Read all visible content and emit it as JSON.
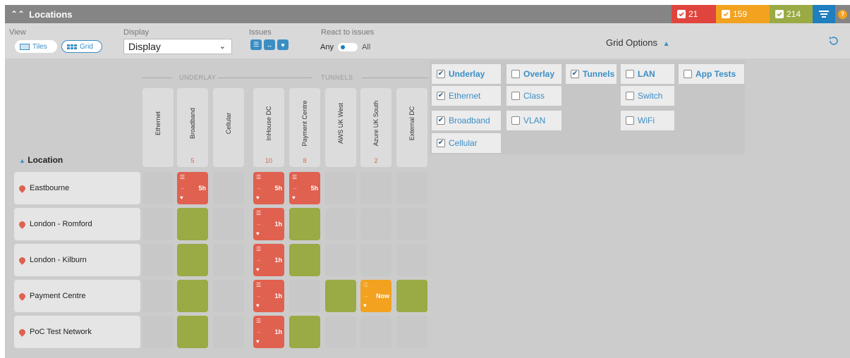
{
  "header": {
    "title": "Locations",
    "badges": [
      {
        "label": "21",
        "color": "#e0453d"
      },
      {
        "label": "159",
        "color": "#f2a21f"
      },
      {
        "label": "214",
        "color": "#9aaa44"
      }
    ],
    "filter_icon": "filter-icon",
    "help_label": "?"
  },
  "toolbar": {
    "view_label": "View",
    "view_options": [
      "Tiles",
      "Grid"
    ],
    "display_label": "Display",
    "display_value": "Display",
    "issues_label": "Issues",
    "react_label": "React to issues",
    "react_options": [
      "Any",
      "All"
    ],
    "grid_options_label": "Grid Options",
    "refresh_icon": "refresh-icon"
  },
  "grid": {
    "groups": [
      "UNDERLAY",
      "TUNNELS"
    ],
    "sort_label": "Location",
    "columns": [
      {
        "label": "Ethernet",
        "count": ""
      },
      {
        "label": "Broadband",
        "count": "5"
      },
      {
        "label": "Cellular",
        "count": ""
      },
      {
        "label": "InHouse DC",
        "count": "10"
      },
      {
        "label": "Payment Centre",
        "count": "8"
      },
      {
        "label": "AWS UK West",
        "count": ""
      },
      {
        "label": "Azure UK South",
        "count": "2"
      },
      {
        "label": "External DC",
        "count": ""
      }
    ],
    "rows": [
      {
        "name": "Eastbourne",
        "cells": [
          {
            "s": "empty"
          },
          {
            "s": "red",
            "t": "5h"
          },
          {
            "s": "empty"
          },
          {
            "s": "red",
            "t": "5h"
          },
          {
            "s": "red",
            "t": "5h"
          },
          {
            "s": "empty"
          },
          {
            "s": "empty"
          },
          {
            "s": "empty"
          }
        ]
      },
      {
        "name": "London - Romford",
        "cells": [
          {
            "s": "empty"
          },
          {
            "s": "green"
          },
          {
            "s": "empty"
          },
          {
            "s": "red",
            "t": "1h"
          },
          {
            "s": "green"
          },
          {
            "s": "empty"
          },
          {
            "s": "empty"
          },
          {
            "s": "empty"
          }
        ]
      },
      {
        "name": "London - Kilburn",
        "cells": [
          {
            "s": "empty"
          },
          {
            "s": "green"
          },
          {
            "s": "empty"
          },
          {
            "s": "red",
            "t": "1h"
          },
          {
            "s": "green"
          },
          {
            "s": "empty"
          },
          {
            "s": "empty"
          },
          {
            "s": "empty"
          }
        ]
      },
      {
        "name": "Payment Centre",
        "cells": [
          {
            "s": "empty"
          },
          {
            "s": "green"
          },
          {
            "s": "empty"
          },
          {
            "s": "red",
            "t": "1h"
          },
          {
            "s": "empty"
          },
          {
            "s": "green"
          },
          {
            "s": "orange",
            "t": "Now"
          },
          {
            "s": "green"
          }
        ]
      },
      {
        "name": "PoC Test Network",
        "cells": [
          {
            "s": "empty"
          },
          {
            "s": "green"
          },
          {
            "s": "empty"
          },
          {
            "s": "red",
            "t": "1h"
          },
          {
            "s": "green"
          },
          {
            "s": "empty"
          },
          {
            "s": "empty"
          },
          {
            "s": "empty"
          }
        ]
      }
    ]
  },
  "grid_options": {
    "columns": [
      {
        "items": [
          {
            "label": "Underlay",
            "checked": true,
            "bold": true
          },
          {
            "label": "Ethernet",
            "checked": true
          },
          {
            "label": "Broadband",
            "checked": true
          },
          {
            "label": "Cellular",
            "checked": true
          }
        ]
      },
      {
        "items": [
          {
            "label": "Overlay",
            "checked": false,
            "bold": true
          },
          {
            "label": "Class",
            "checked": false
          },
          {
            "label": "VLAN",
            "checked": false
          }
        ]
      },
      {
        "items": [
          {
            "label": "Tunnels",
            "checked": true,
            "bold": true
          }
        ]
      },
      {
        "items": [
          {
            "label": "LAN",
            "checked": false,
            "bold": true
          },
          {
            "label": "Switch",
            "checked": false
          },
          {
            "label": "WiFi",
            "checked": false
          }
        ]
      },
      {
        "items": [
          {
            "label": "App Tests",
            "checked": false,
            "bold": true
          }
        ]
      }
    ]
  },
  "colors": {
    "red": "#e0614f",
    "green": "#9aaa44",
    "orange": "#f2a21f",
    "accent": "#3b8ec4"
  }
}
